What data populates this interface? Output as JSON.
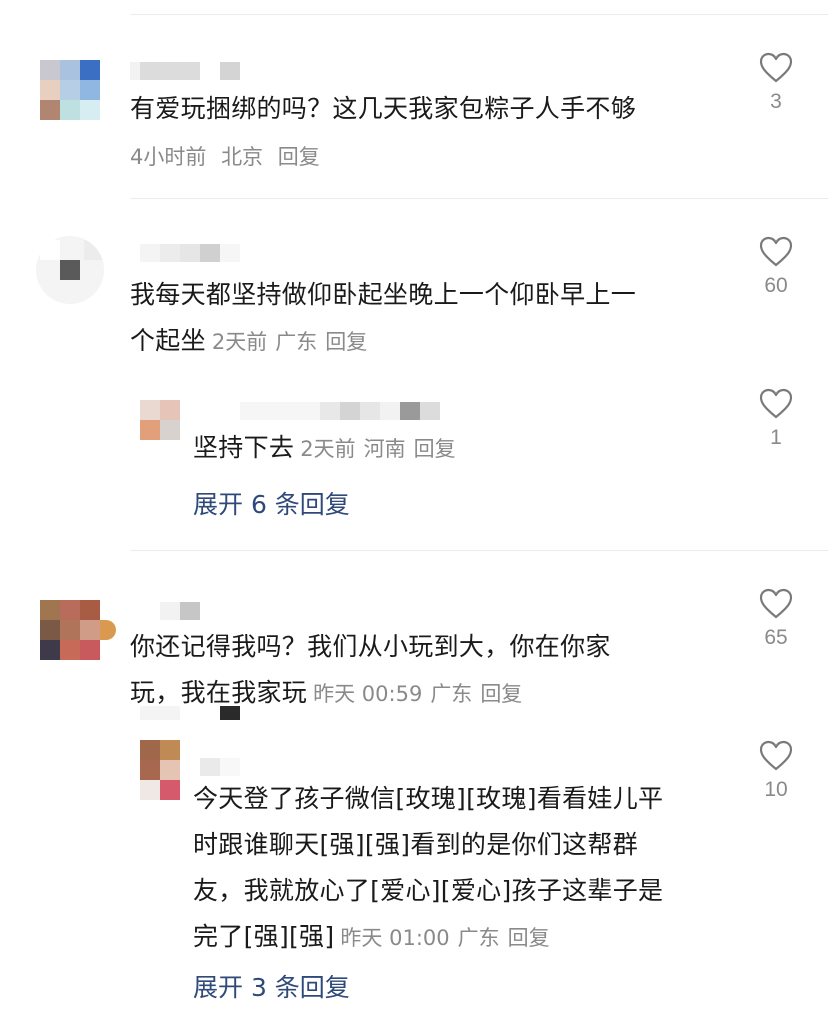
{
  "comments": [
    {
      "text": "有爱玩捆绑的吗？这几天我家包粽子人手不够",
      "time": "4小时前",
      "location": "北京",
      "reply_label": "回复",
      "likes": "3"
    },
    {
      "text_line1": "我每天都坚持做仰卧起坐晚上一个仰卧早上一",
      "text_line2": "个起坐",
      "time": "2天前",
      "location": "广东",
      "reply_label": "回复",
      "likes": "60",
      "reply": {
        "text": "坚持下去",
        "time": "2天前",
        "location": "河南",
        "reply_label": "回复",
        "likes": "1"
      },
      "expand_label": "展开 6 条回复"
    },
    {
      "text_line1": "你还记得我吗？我们从小玩到大，你在你家",
      "text_line2": "玩，我在我家玩",
      "time": "昨天 00:59",
      "location": "广东",
      "reply_label": "回复",
      "likes": "65",
      "reply": {
        "line1": "今天登了孩子微信[玫瑰][玫瑰]看看娃儿平",
        "line2": "时跟谁聊天[强][强]看到的是你们这帮群",
        "line3": "友，我就放心了[爱心][爱心]孩子这辈子是",
        "line4": "完了[强][强]",
        "time": "昨天 01:00",
        "location": "广东",
        "reply_label": "回复",
        "likes": "10"
      },
      "expand_label": "展开 3 条回复"
    }
  ],
  "icons": {
    "like": "heart-outline-icon"
  },
  "colors": {
    "text": "#1a1a1a",
    "meta": "#8a8a8a",
    "link": "#2f4a7a",
    "divider": "#ececec"
  }
}
